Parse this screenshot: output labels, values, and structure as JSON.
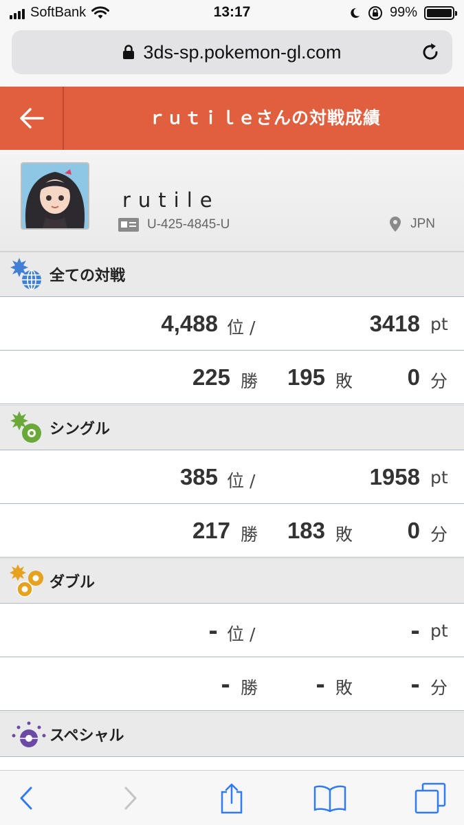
{
  "status_bar": {
    "carrier": "SoftBank",
    "time": "13:17",
    "battery": "99%"
  },
  "browser": {
    "url": "3ds-sp.pokemon-gl.com"
  },
  "header": {
    "title": "ｒｕｔｉｌｅさんの対戦成績"
  },
  "profile": {
    "name": "rutile",
    "player_id": "U-425-4845-U",
    "region": "JPN"
  },
  "sections": [
    {
      "title": "全ての対戦",
      "icon": "globe-icon",
      "rank": "4,488",
      "points": "3418",
      "wins": "225",
      "losses": "195",
      "draws": "0"
    },
    {
      "title": "シングル",
      "icon": "single-ball-icon",
      "rank": "385",
      "points": "1958",
      "wins": "217",
      "losses": "183",
      "draws": "0"
    },
    {
      "title": "ダブル",
      "icon": "double-ball-icon",
      "rank": "-",
      "points": "-",
      "wins": "-",
      "losses": "-",
      "draws": "-"
    },
    {
      "title": "スペシャル",
      "icon": "special-ball-icon"
    }
  ],
  "units": {
    "rank": "位 /",
    "points": "pt",
    "wins": "勝",
    "losses": "敗",
    "draws": "分"
  },
  "colors": {
    "header": "#e05f3e",
    "all_battles_icon": "#3f7fd6",
    "single_icon": "#6aa83a",
    "double_icon": "#e6a11f",
    "special_icon": "#6b4aa6"
  }
}
